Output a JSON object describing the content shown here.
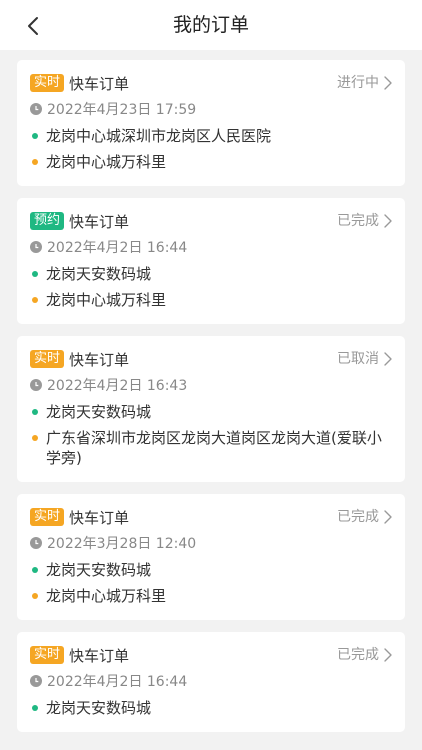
{
  "header": {
    "title": "我的订单",
    "back_icon": "chevron-left-icon"
  },
  "colors": {
    "realtime_badge": "#f5a623",
    "reserve_badge": "#1fb882",
    "start_dot": "#1fb882",
    "end_dot": "#f5a623",
    "status_text": "#999999"
  },
  "orders": [
    {
      "badge": "实时",
      "badge_color": "orange",
      "type": "快车订单",
      "status": "进行中",
      "time": "2022年4月23日 17:59",
      "start": "龙岗中心城深圳市龙岗区人民医院",
      "end": "龙岗中心城万科里"
    },
    {
      "badge": "预约",
      "badge_color": "green",
      "type": "快车订单",
      "status": "已完成",
      "time": "2022年4月2日 16:44",
      "start": "龙岗天安数码城",
      "end": "龙岗中心城万科里"
    },
    {
      "badge": "实时",
      "badge_color": "orange",
      "type": "快车订单",
      "status": "已取消",
      "time": "2022年4月2日 16:43",
      "start": "龙岗天安数码城",
      "end": "广东省深圳市龙岗区龙岗大道岗区龙岗大道(爱联小学旁)"
    },
    {
      "badge": "实时",
      "badge_color": "orange",
      "type": "快车订单",
      "status": "已完成",
      "time": "2022年3月28日 12:40",
      "start": "龙岗天安数码城",
      "end": "龙岗中心城万科里"
    },
    {
      "badge": "实时",
      "badge_color": "orange",
      "type": "快车订单",
      "status": "已完成",
      "time": "2022年4月2日 16:44",
      "start": "龙岗天安数码城",
      "end": ""
    }
  ]
}
